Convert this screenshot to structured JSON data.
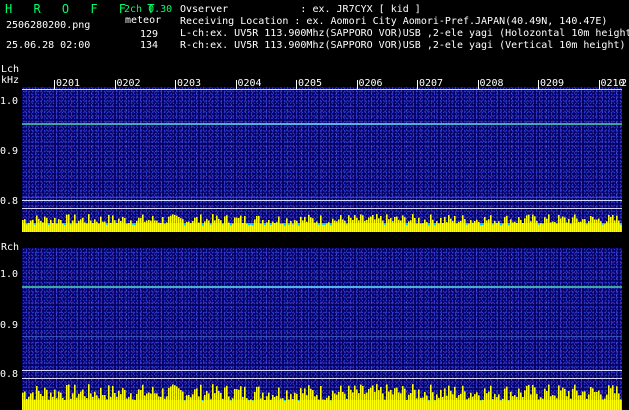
{
  "header": {
    "app_title": "H R O F F T",
    "version": "2ch 0.30",
    "filename": "2506280200.png",
    "mode": "meteor",
    "datetime": "25.06.28 02:00",
    "count_l": "129",
    "count_r": "134",
    "observer": "Ovserver            : ex. JR7CYX [ kid ]",
    "location": "Receiving Location : ex. Aomori City Aomori-Pref.JAPAN(40.49N, 140.47E)",
    "lch_info": "L-ch:ex. UV5R 113.900Mhz(SAPPORO VOR)USB ,2-ele yagi (Holozontal 10m height)",
    "rch_info": "R-ch:ex. UV5R 113.900Mhz(SAPPORO VOR)USB ,2-ele yagi (Vertical 10m height)"
  },
  "lch": {
    "label": "Lch",
    "unit": "kHz",
    "yticks": [
      "1.0",
      "0.9",
      "0.8"
    ],
    "time_ticks": [
      "0201",
      "0202",
      "0203",
      "0204",
      "0205",
      "0206",
      "0207",
      "0208",
      "0209",
      "0210"
    ],
    "edge_tick": "2"
  },
  "rch": {
    "label": "Rch",
    "yticks": [
      "1.0",
      "0.9",
      "0.8"
    ]
  },
  "colors": {
    "title_green": "#00ff66",
    "spectrum_bg": "#020060",
    "signal_line": "#60d0ff",
    "bar_yellow": "#ffff00",
    "bar_cyan": "#00c8ff"
  }
}
